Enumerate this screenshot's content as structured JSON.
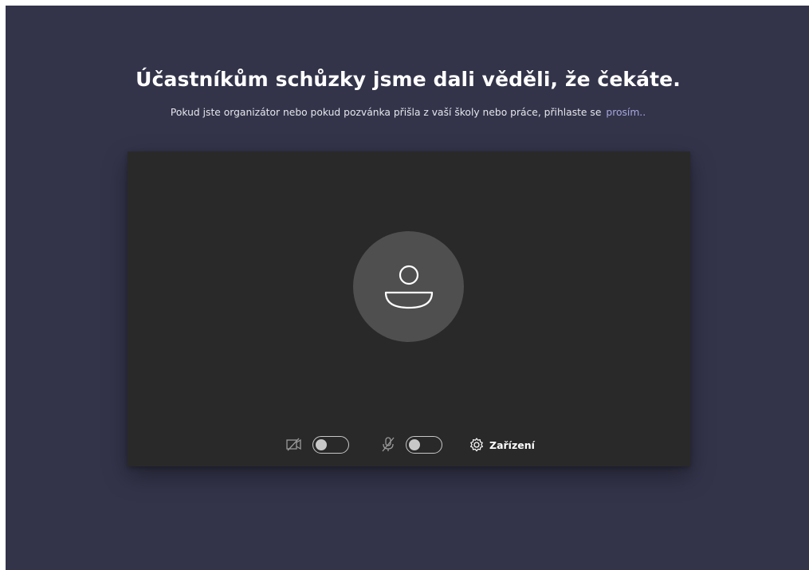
{
  "header": {
    "title": "Účastníkům schůzky jsme dali věděli, že čekáte.",
    "subtitle": "Pokud jste organizátor nebo pokud pozvánka přišla z vaší školy nebo práce, přihlaste se",
    "signin_link": "prosím.."
  },
  "preview": {
    "avatar_icon": "person-icon",
    "camera": {
      "icon": "camera-off-icon",
      "enabled": false
    },
    "microphone": {
      "icon": "mic-off-icon",
      "enabled": false
    },
    "devices": {
      "icon": "gear-icon",
      "label": "Zařízení"
    }
  },
  "colors": {
    "background": "#33344a",
    "preview_bg": "#292929",
    "avatar_bg": "#4f4f4f",
    "link": "#a6a7dc",
    "text": "#ffffff"
  }
}
